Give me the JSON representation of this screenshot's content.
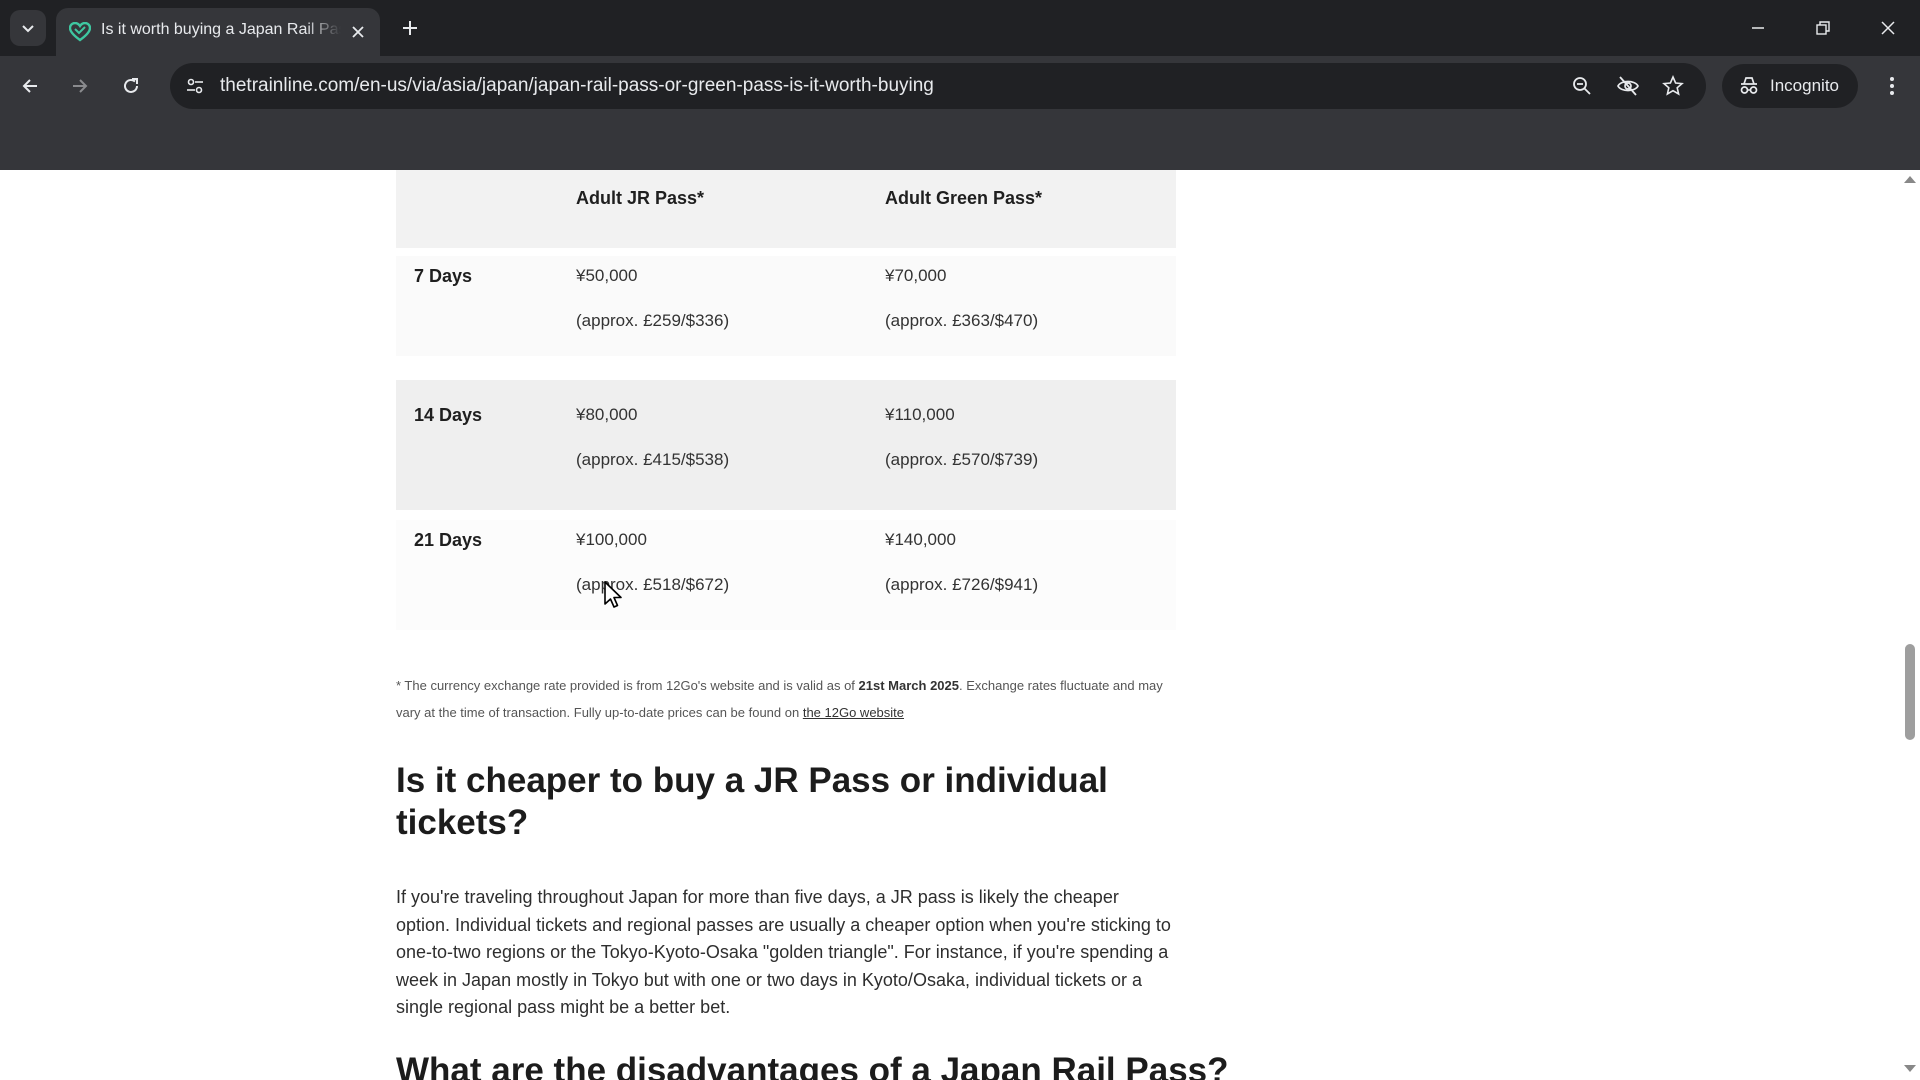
{
  "browser": {
    "tab_title": "Is it worth buying a Japan Rail Pass",
    "url": "thetrainline.com/en-us/via/asia/japan/japan-rail-pass-or-green-pass-is-it-worth-buying",
    "incognito_label": "Incognito",
    "icons": [
      "chevron-down-icon",
      "heart-favicon-icon",
      "close-icon",
      "plus-icon",
      "minimize-icon",
      "restore-icon",
      "close-window-icon",
      "back-icon",
      "forward-icon",
      "reload-icon",
      "site-settings-icon",
      "zoom-icon",
      "eye-off-icon",
      "star-icon",
      "incognito-icon",
      "kebab-menu-icon"
    ],
    "colors": {
      "tabbar": "#202124",
      "toolbar": "#35363a",
      "favicon": "#3ec7a0"
    }
  },
  "table": {
    "headers": [
      "",
      "Adult JR Pass*",
      "Adult Green Pass*"
    ],
    "rows": [
      {
        "days": "7 Days",
        "jr_price": "¥50,000",
        "jr_approx": "(approx. £259/$336)",
        "green_price": "¥70,000",
        "green_approx": "(approx. £363/$470)"
      },
      {
        "days": "14 Days",
        "jr_price": "¥80,000",
        "jr_approx": "(approx. £415/$538)",
        "green_price": "¥110,000",
        "green_approx": "(approx. £570/$739)"
      },
      {
        "days": "21 Days",
        "jr_price": "¥100,000",
        "jr_approx": "(approx. £518/$672)",
        "green_price": "¥140,000",
        "green_approx": "(approx. £726/$941)"
      }
    ]
  },
  "footnote": {
    "text1": "* The currency exchange rate provided is from 12Go's website and is valid as of ",
    "date": "21st March 2025",
    "text2": ". Exchange rates fluctuate and may vary at the time of transaction. Fully up-to-date prices can be found on ",
    "link": "the 12Go website"
  },
  "article": {
    "heading": "Is it cheaper to buy a JR Pass or individual tickets?",
    "paragraph": "If you're traveling throughout Japan for more than five days, a JR pass is likely the cheaper option. Individual tickets and regional passes are usually a cheaper option when you're sticking to one-to-two regions or the Tokyo-Kyoto-Osaka \"golden triangle\". For instance, if you're spending a week in Japan mostly in Tokyo but with one or two days in Kyoto/Osaka, individual tickets or a single regional pass might be a better bet.",
    "next_heading": "What are the disadvantages of a Japan Rail Pass?"
  }
}
